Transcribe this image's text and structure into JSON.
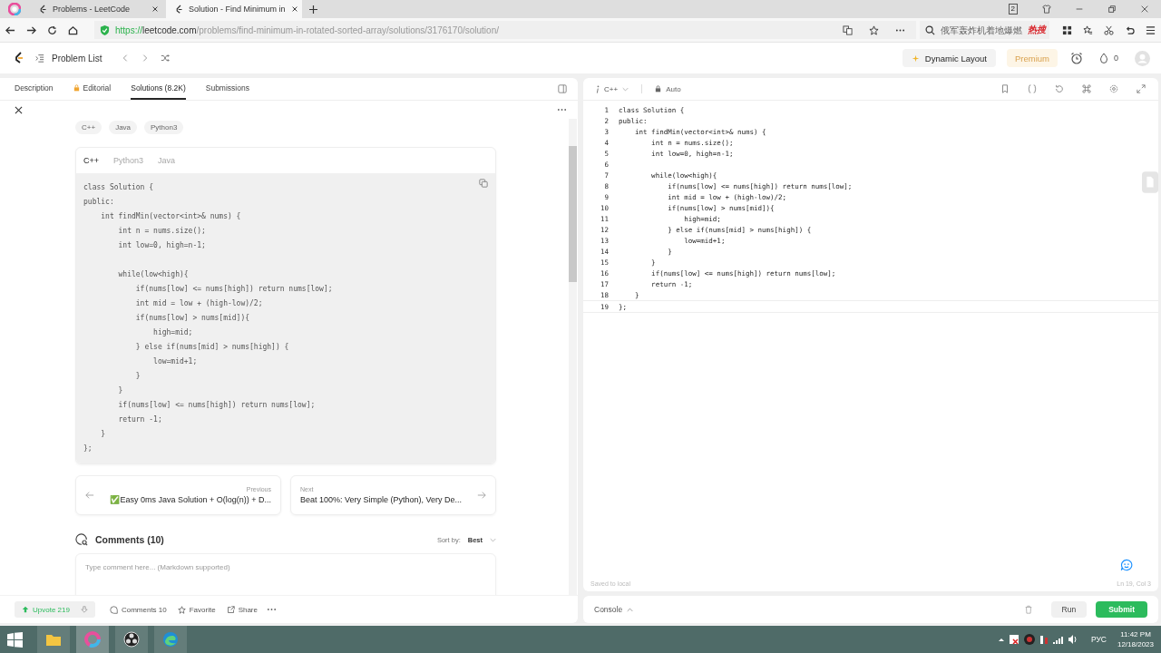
{
  "browser": {
    "tabs": [
      {
        "title": "Problems - LeetCode",
        "selected": false
      },
      {
        "title": "Solution - Find Minimum in",
        "selected": true
      }
    ],
    "tab_count": "2",
    "address": {
      "scheme": "https://",
      "host": "leetcode.com",
      "path": "/problems/find-minimum-in-rotated-sorted-array/solutions/3176170/solution/"
    },
    "search": {
      "placeholder": "俄军轰炸机着地爆燃",
      "badge": "热搜"
    }
  },
  "header": {
    "problem_list": "Problem List",
    "dynamic_layout": "Dynamic Layout",
    "premium": "Premium",
    "streak": "0"
  },
  "left_tabs": [
    {
      "label": "Description",
      "selected": false,
      "kind": "plain"
    },
    {
      "label": "Editorial",
      "selected": false,
      "kind": "locked"
    },
    {
      "label": "Solutions (8.2K)",
      "selected": true,
      "kind": "plain"
    },
    {
      "label": "Submissions",
      "selected": false,
      "kind": "plain"
    }
  ],
  "tags": [
    "C++",
    "Java",
    "Python3"
  ],
  "code_tabs": [
    {
      "label": "C++",
      "selected": true
    },
    {
      "label": "Python3",
      "selected": false
    },
    {
      "label": "Java",
      "selected": false
    }
  ],
  "solution_code": [
    {
      "code": "class Solution {"
    },
    {
      "code": "public:"
    },
    {
      "code": "    int findMin(vector<int>& nums) {"
    },
    {
      "code": "        int n = nums.size();"
    },
    {
      "code": "        int low=0, high=n-1;"
    },
    {
      "code": "        while(low<high){",
      "gap_before": true
    },
    {
      "code": "            if(nums[low] <= nums[high]) return nums[low];"
    },
    {
      "code": "            int mid = low + (high-low)/2;"
    },
    {
      "code": "            if(nums[low] > nums[mid]){"
    },
    {
      "code": "                high=mid;"
    },
    {
      "code": "            } else if(nums[mid] > nums[high]) {"
    },
    {
      "code": "                low=mid+1;"
    },
    {
      "code": "            }"
    },
    {
      "code": "        }"
    },
    {
      "code": "        if(nums[low] <= nums[high]) return nums[low];"
    },
    {
      "code": "        return -1;"
    },
    {
      "code": "    }"
    },
    {
      "code": "};"
    }
  ],
  "previous": {
    "label": "Previous",
    "title": "✅Easy 0ms Java Solution + O(log(n)) + D..."
  },
  "next": {
    "label": "Next",
    "title": "Beat 100%: Very Simple (Python), Very De..."
  },
  "comments": {
    "title": "Comments (10)",
    "sort_label": "Sort by:",
    "sort_value": "Best",
    "placeholder": "Type comment here... (Markdown supported)"
  },
  "actions": {
    "upvote": "Upvote 219",
    "comments": "Comments 10",
    "favorite": "Favorite",
    "share": "Share"
  },
  "editor": {
    "language": "C++",
    "mode": "Auto",
    "lines": [
      {
        "n": "1",
        "code": "class Solution {"
      },
      {
        "n": "2",
        "code": "public:"
      },
      {
        "n": "3",
        "code": "    int findMin(vector<int>& nums) {"
      },
      {
        "n": "4",
        "code": "        int n = nums.size();"
      },
      {
        "n": "5",
        "code": "        int low=0, high=n-1;"
      },
      {
        "n": "6"
      },
      {
        "n": "7",
        "code": "        while(low<high){"
      },
      {
        "n": "8",
        "code": "            if(nums[low] <= nums[high]) return nums[low];"
      },
      {
        "n": "9",
        "code": "            int mid = low + (high-low)/2;"
      },
      {
        "n": "10",
        "code": "            if(nums[low] > nums[mid]){"
      },
      {
        "n": "11",
        "code": "                high=mid;"
      },
      {
        "n": "12",
        "code": "            } else if(nums[mid] > nums[high]) {"
      },
      {
        "n": "13",
        "code": "                low=mid+1;"
      },
      {
        "n": "14",
        "code": "            }"
      },
      {
        "n": "15",
        "code": "        }"
      },
      {
        "n": "16",
        "code": "        if(nums[low] <= nums[high]) return nums[low];"
      },
      {
        "n": "17",
        "code": "        return -1;"
      },
      {
        "n": "18",
        "code": "    }"
      },
      {
        "n": "19",
        "code": "};"
      }
    ],
    "saved": "Saved to local",
    "position": "Ln 19, Col 3"
  },
  "console": {
    "label": "Console",
    "run": "Run",
    "submit": "Submit"
  },
  "taskbar": {
    "language": "РУС",
    "time": "11:42 PM",
    "date": "12/18/2023"
  }
}
